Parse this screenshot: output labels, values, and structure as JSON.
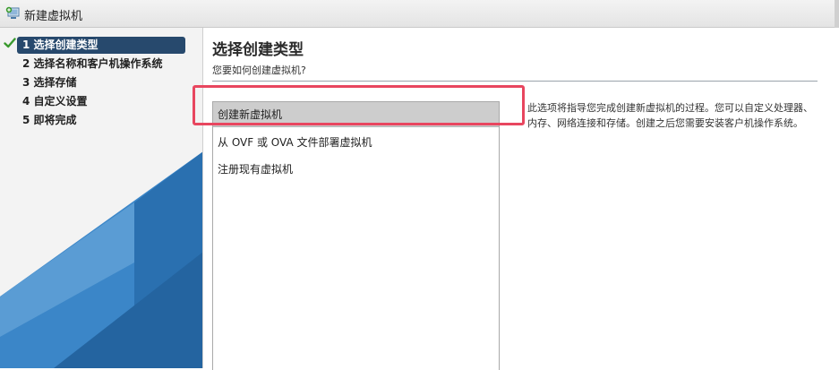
{
  "window": {
    "title": "新建虚拟机",
    "icon": "new-vm-wizard-icon"
  },
  "steps": [
    {
      "label": "1 选择创建类型",
      "completed": true,
      "active": true
    },
    {
      "label": "2 选择名称和客户机操作系统",
      "completed": false,
      "active": false
    },
    {
      "label": "3 选择存储",
      "completed": false,
      "active": false
    },
    {
      "label": "4 自定义设置",
      "completed": false,
      "active": false
    },
    {
      "label": "5 即将完成",
      "completed": false,
      "active": false
    }
  ],
  "main": {
    "title": "选择创建类型",
    "subtitle": "您要如何创建虚拟机?",
    "creation_types": [
      {
        "label": "创建新虚拟机",
        "selected": true
      },
      {
        "label": "从 OVF 或 OVA 文件部署虚拟机",
        "selected": false
      },
      {
        "label": "注册现有虚拟机",
        "selected": false
      }
    ],
    "description": "此选项将指导您完成创建新虚拟机的过程。您可以自定义处理器、内存、网络连接和存储。创建之后您需要安装客户机操作系统。"
  },
  "colors": {
    "active_step_bg": "#27496d",
    "selected_item_bg": "#cdcdcd",
    "highlight_border": "#e8465f",
    "check_green": "#3a9a2e",
    "panel_art_blue": "#2f7bbf"
  }
}
